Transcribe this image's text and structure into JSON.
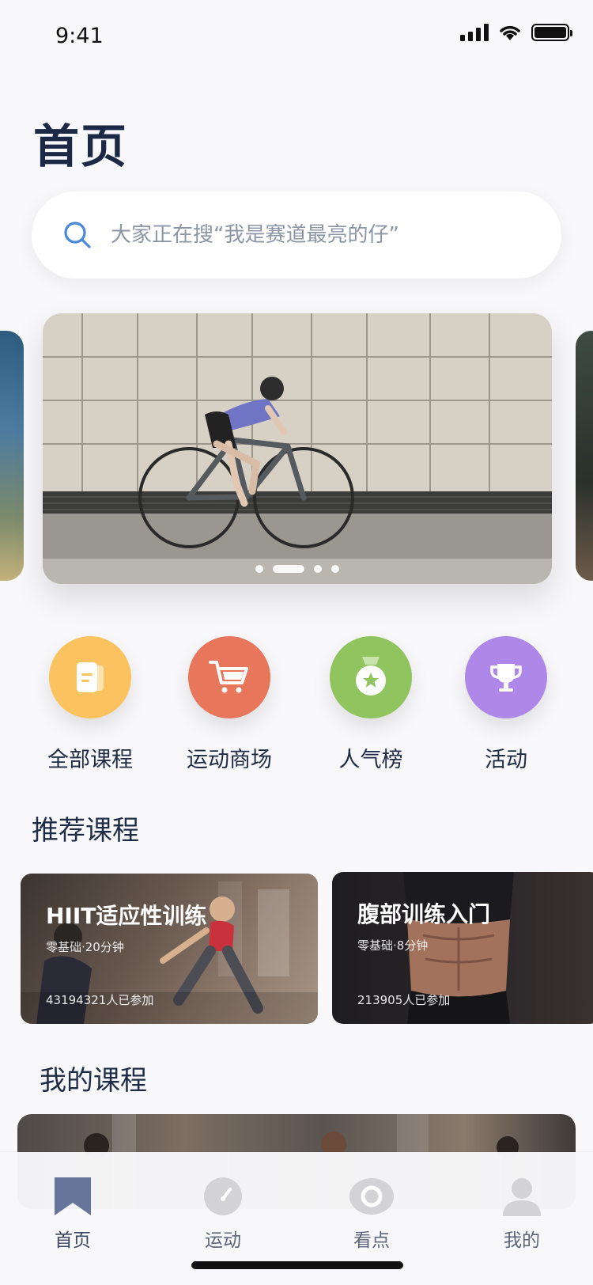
{
  "status_bar": {
    "time": "9:41"
  },
  "page": {
    "title": "首页"
  },
  "search": {
    "placeholder": "大家正在搜“我是赛道最亮的仔”"
  },
  "carousel": {
    "slide_count": 4,
    "active_slide": 2
  },
  "categories": [
    {
      "label": "全部课程",
      "icon": "document-icon",
      "color": "#FBC260"
    },
    {
      "label": "运动商场",
      "icon": "shopping-cart-icon",
      "color": "#E8765A"
    },
    {
      "label": "人气榜",
      "icon": "medal-icon",
      "color": "#8FC45E"
    },
    {
      "label": "活动",
      "icon": "trophy-icon",
      "color": "#AE87E8"
    }
  ],
  "recommended": {
    "title": "推荐课程",
    "courses": [
      {
        "title": "HIIT适应性训练",
        "subtitle": "零基础·20分钟",
        "participants": "43194321人已参加"
      },
      {
        "title": "腹部训练入门",
        "subtitle": "零基础·8分钟",
        "participants": "213905人已参加"
      }
    ]
  },
  "my_courses": {
    "title": "我的课程"
  },
  "tabbar": {
    "items": [
      {
        "label": "首页",
        "icon": "bookmark-icon",
        "active": true
      },
      {
        "label": "运动",
        "icon": "gauge-icon",
        "active": false
      },
      {
        "label": "看点",
        "icon": "eye-icon",
        "active": false
      },
      {
        "label": "我的",
        "icon": "user-icon",
        "active": false
      }
    ]
  },
  "colors": {
    "background": "#F8F8FA",
    "title": "#1B2947",
    "tab_active": "#65769A",
    "tab_inactive": "#D3D3D6"
  }
}
